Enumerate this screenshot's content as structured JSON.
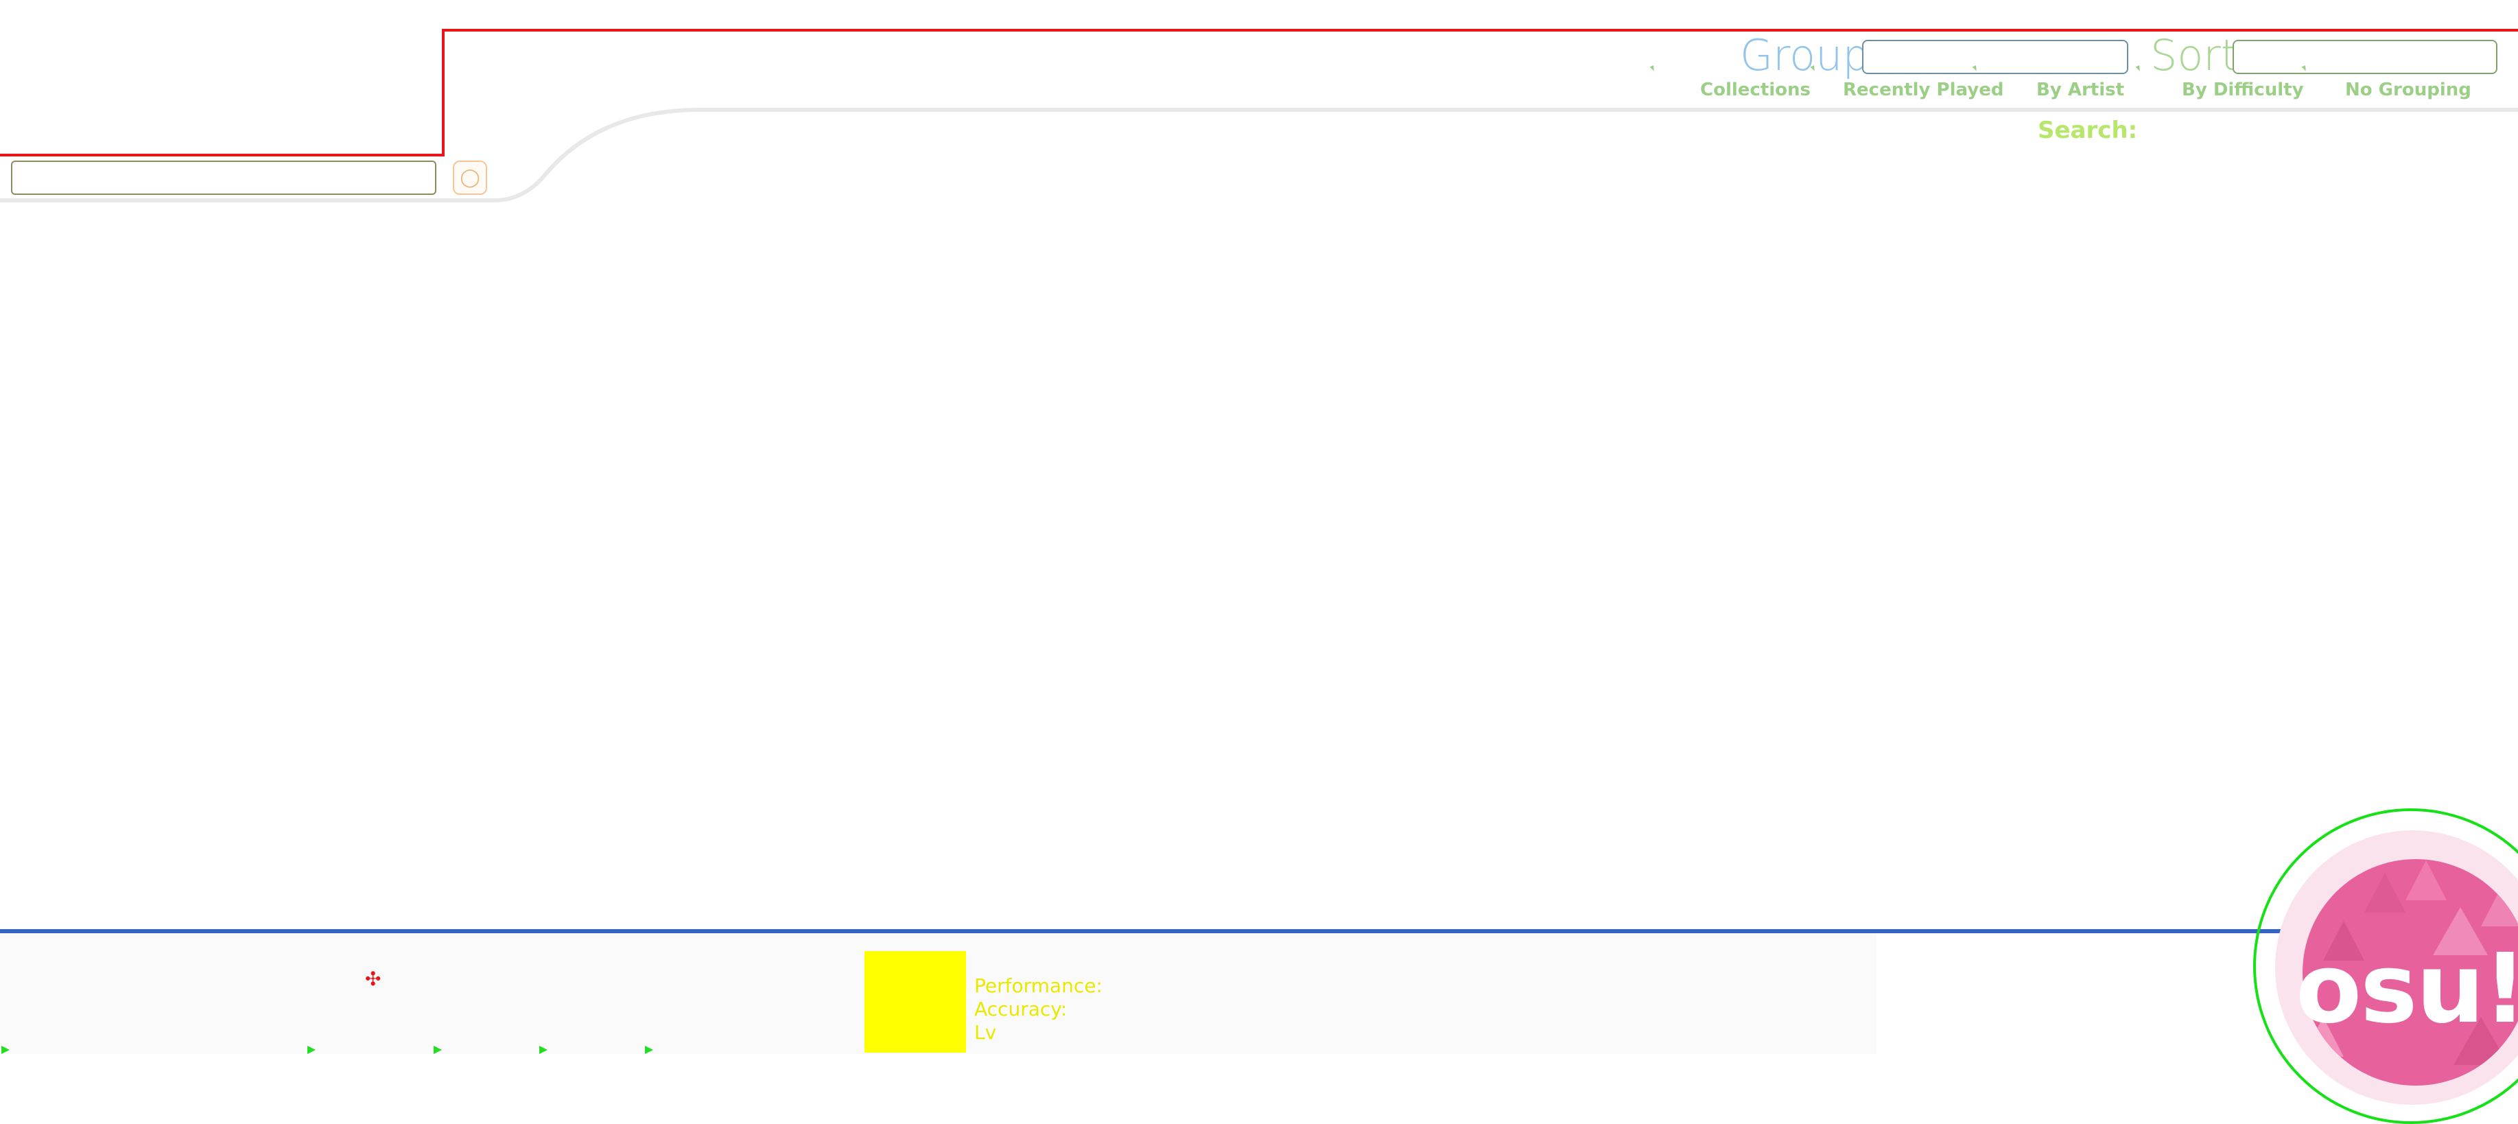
{
  "header": {
    "group_label": "Group",
    "sort_label": "Sort",
    "tabs": [
      "Collections",
      "Recently Played",
      "By Artist",
      "By Difficulty",
      "No Grouping"
    ],
    "search_label": "Search:"
  },
  "search": {
    "placeholder": "",
    "value": ""
  },
  "footer": {
    "performance_label": "Performance:",
    "accuracy_label": "Accuracy:",
    "level_label": "Lv"
  },
  "logo": {
    "text": "osu!"
  },
  "colors": {
    "red_border": "#e8151b",
    "group_blue": "#92c4ec",
    "sort_green": "#a8d693",
    "search_lime": "#b6e76b",
    "bar_blue": "#3663c4",
    "yellow_box": "#ffff00",
    "osu_pink": "#e7619d"
  }
}
